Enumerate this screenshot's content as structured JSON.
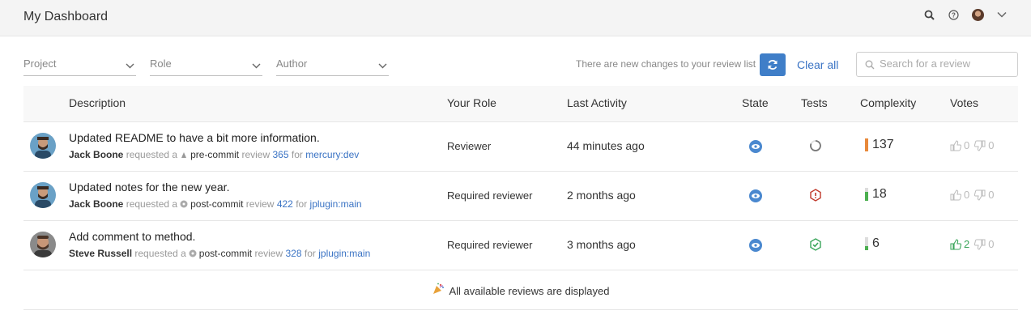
{
  "header": {
    "title": "My Dashboard",
    "icons": [
      "search-icon",
      "help-icon",
      "user-avatar",
      "chevron-down-icon"
    ]
  },
  "filters": {
    "project": "Project",
    "role": "Role",
    "author": "Author",
    "notice": "There are new changes to your review list",
    "clear": "Clear all",
    "search_placeholder": "Search for a review"
  },
  "table": {
    "columns": {
      "description": "Description",
      "role": "Your Role",
      "activity": "Last Activity",
      "state": "State",
      "tests": "Tests",
      "complexity": "Complexity",
      "votes": "Votes"
    },
    "rows": [
      {
        "title": "Updated README to have a bit more information.",
        "author": "Jack Boone",
        "requested_a": "requested a",
        "type": "pre-commit",
        "review_word": "review",
        "review_id": "365",
        "for_word": "for",
        "branch": "mercury:dev",
        "role": "Reviewer",
        "activity": "44 minutes ago",
        "state": "eye-icon",
        "tests": "loading-icon",
        "complexity": "137",
        "up": "0",
        "down": "0"
      },
      {
        "title": "Updated notes for the new year.",
        "author": "Jack Boone",
        "requested_a": "requested a",
        "type": "post-commit",
        "review_word": "review",
        "review_id": "422",
        "for_word": "for",
        "branch": "jplugin:main",
        "role": "Required reviewer",
        "activity": "2 months ago",
        "state": "eye-icon",
        "tests": "failed-icon",
        "complexity": "18",
        "up": "0",
        "down": "0"
      },
      {
        "title": "Add comment to method.",
        "author": "Steve Russell",
        "requested_a": "requested a",
        "type": "post-commit",
        "review_word": "review",
        "review_id": "328",
        "for_word": "for",
        "branch": "jplugin:main",
        "role": "Required reviewer",
        "activity": "3 months ago",
        "state": "eye-icon",
        "tests": "passed-icon",
        "complexity": "6",
        "up": "2",
        "down": "0"
      }
    ],
    "footer": "All available reviews are displayed"
  },
  "colors": {
    "accent": "#3f7ec8",
    "link": "#3a73c4",
    "pass": "#3aa55a",
    "fail": "#c0392b",
    "complexity_high": "#e8893a",
    "complexity_low": "#4caf50"
  }
}
